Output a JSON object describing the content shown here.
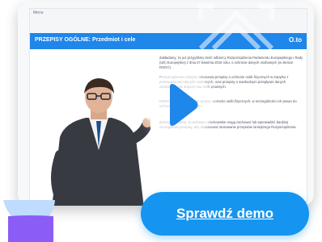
{
  "menu": {
    "label": "Menu"
  },
  "lesson": {
    "title": "PRZEPISY OGÓLNE: Przedmiot i cele",
    "logo": "O.to"
  },
  "content": {
    "paragraphs": [
      "Zakładamy, że już przyjęliśmy treść odbiorcy Rozporządzenia Parlamentu Europejskiego i Rady (UE) Europejskiej z dnia 27 kwietnia 2016 roku, o ochronie danych osobowych (w skrócie RODO).",
      "Rozporządzenie niniejsze ustanawia przepisy o ochronie osób fizycznych w związku z przetwarzaniem danych osobowych, oraz przepisy o swobodnym przepływie danych osobowych; nie dotyczy ono osób prawnych.",
      "RODO chroni podstawowe prawa i wolności osób fizycznych, w szczególności ich prawo do ochrony danych osobowych.",
      "Zaznaczyć należy, że państwa członkowskie mogą zachować lub wprowadzić bardziej szczegółowe przepisy, aby dostosować stosowanie przepisów niniejszego Rozporządzenia."
    ]
  },
  "cta": {
    "label": "Sprawdź demo"
  },
  "colors": {
    "accent": "#1595f0",
    "header": "#1f86ea",
    "blob": "#8b5cf6"
  },
  "icons": {
    "play": "play-icon",
    "decor": "decorative-arrows-icon"
  }
}
